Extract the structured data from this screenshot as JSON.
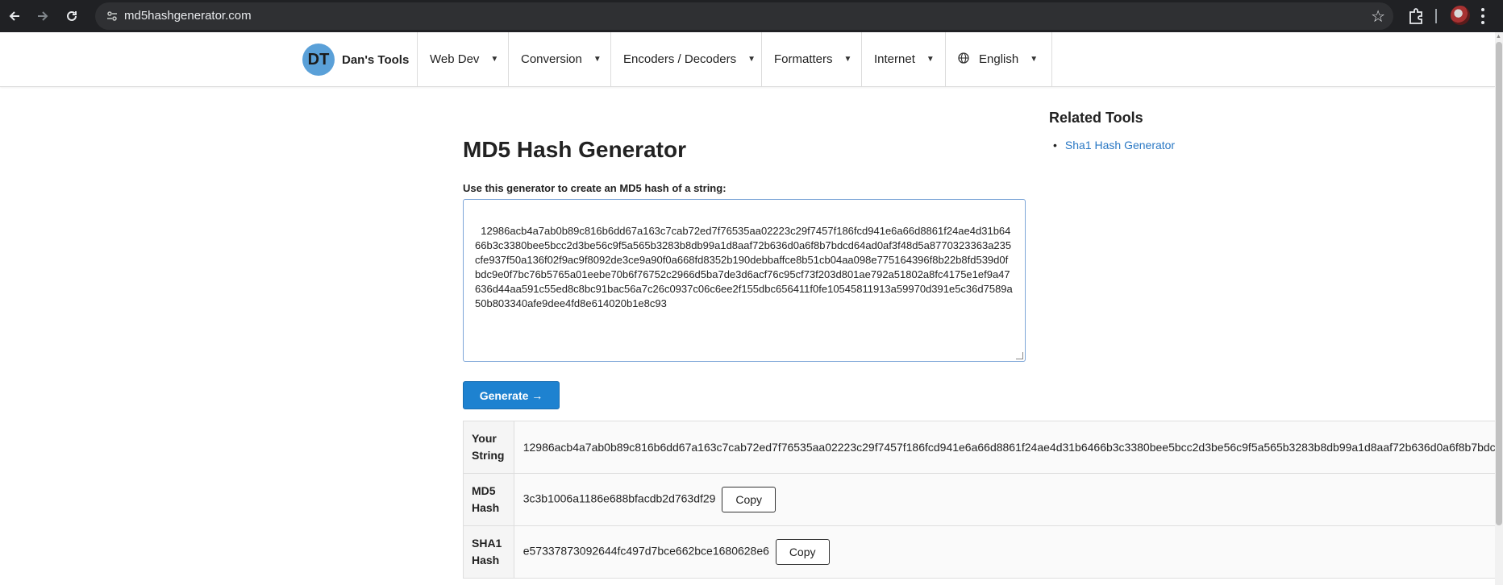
{
  "browser": {
    "url": "md5hashgenerator.com",
    "icons": [
      "back-arrow-icon",
      "forward-arrow-icon",
      "reload-icon",
      "site-info-icon",
      "bookmark-star-icon",
      "extensions-icon",
      "profile-avatar",
      "more-menu-icon"
    ]
  },
  "nav": {
    "brand_initials": "DT",
    "brand_name": "Dan's Tools",
    "items": [
      "Web Dev",
      "Conversion",
      "Encoders / Decoders",
      "Formatters",
      "Internet"
    ],
    "language": "English"
  },
  "main": {
    "title": "MD5 Hash Generator",
    "prompt": "Use this generator to create an MD5 hash of a string:",
    "input_value": "12986acb4a7ab0b89c816b6dd67a163c7cab72ed7f76535aa02223c29f7457f186fcd941e6a66d8861f24ae4d31b6466b3c3380bee5bcc2d3be56c9f5a565b3283b8db99a1d8aaf72b636d0a6f8b7bdcd64ad0af3f48d5a8770323363a235cfe937f50a136f02f9ac9f8092de3ce9a90f0a668fd8352b190debbaffce8b51cb04aa098e775164396f8b22b8fd539d0fbdc9e0f7bc76b5765a01eebe70b6f76752c2966d5ba7de3d6acf76c95cf73f203d801ae792a51802a8fc4175e1ef9a47636d44aa591c55ed8c8bc91bac56a7c26c0937c06c6ee2f155dbc656411f0fe10545811913a59970d391e5c36d7589a50b803340afe9dee4fd8e614020b1e8c93",
    "generate_label": "Generate →"
  },
  "results": {
    "your_string_label": "Your String",
    "your_string_value": "12986acb4a7ab0b89c816b6dd67a163c7cab72ed7f76535aa02223c29f7457f186fcd941e6a66d8861f24ae4d31b6466b3c3380bee5bcc2d3be56c9f5a565b3283b8db99a1d8aaf72b636d0a6f8b7bdc",
    "md5_label": "MD5 Hash",
    "md5_value": "3c3b1006a1186e688bfacdb2d763df29",
    "sha1_label": "SHA1 Hash",
    "sha1_value": "e57337873092644fc497d7bce662bce1680628e6",
    "copy_label": "Copy"
  },
  "sidebar": {
    "title": "Related Tools",
    "links": [
      "Sha1 Hash Generator"
    ]
  },
  "colors": {
    "accent": "#1e82d0",
    "link": "#2a78c4",
    "logo": "#5aa0d8"
  }
}
